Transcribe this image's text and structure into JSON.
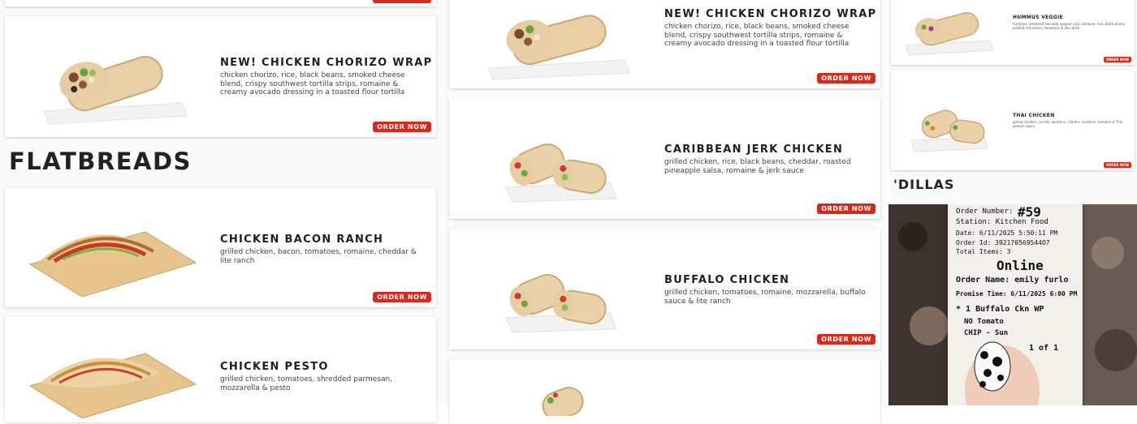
{
  "order_label": "ORDER NOW",
  "col1": {
    "top_card": {
      "title": "NEW! CHICKEN CHORIZO WRAP",
      "desc": "chicken chorizo, rice, black beans, smoked cheese blend, crispy southwest tortilla strips, romaine & creamy avocado dressing in a toasted flour tortilla"
    },
    "section_title": "FLATBREADS",
    "flatbreads": [
      {
        "title": "CHICKEN BACON RANCH",
        "desc": "grilled chicken, bacon, tomatoes, romaine, cheddar & lite ranch"
      },
      {
        "title": "CHICKEN PESTO",
        "desc": "grilled chicken, tomatoes, shredded parmesan, mozzarella & pesto"
      }
    ]
  },
  "col2": {
    "cards": [
      {
        "title": "NEW! CHICKEN CHORIZO WRAP",
        "desc": "chicken chorizo, rice, black beans, smoked cheese blend, crispy southwest tortilla strips, romaine & creamy avocado dressing in a toasted flour tortilla"
      },
      {
        "title": "CARIBBEAN JERK CHICKEN",
        "desc": "grilled chicken, rice, black beans, cheddar, roasted pineapple salsa, romaine & jerk sauce"
      },
      {
        "title": "BUFFALO CHICKEN",
        "desc": "grilled chicken, tomatoes, romaine, mozzarella, buffalo sauce & lite ranch"
      }
    ]
  },
  "col3": {
    "cards": [
      {
        "title": "HUMMUS VEGGIE",
        "desc": "hummus, smashed avocado, pepper jack, romaine, rice, black beans, pickled red onions, tomatoes & lite ranch"
      },
      {
        "title": "THAI CHICKEN",
        "desc": "grilled chicken, carrots, wontons, cilantro, scallions, romaine & Thai peanut sauce"
      }
    ],
    "section_title": "'DILLAS",
    "receipt": {
      "order_number_label": "Order Number:",
      "order_number": "#59",
      "station": "Station: Kitchen Food",
      "date": "Date: 6/11/2025 5:50:11 PM",
      "order_id": "Order Id: 392170569544O7",
      "total_items": "Total Items: 3",
      "channel": "Online",
      "order_name": "Order Name: emily furlo",
      "promise_time": "Promise Time: 6/11/2025 6:00 PM",
      "item1": "* 1 Buffalo Ckn WP",
      "mod1": "NO Tomato",
      "item2": "CHIP - Sun",
      "page": "1 of 1"
    }
  }
}
